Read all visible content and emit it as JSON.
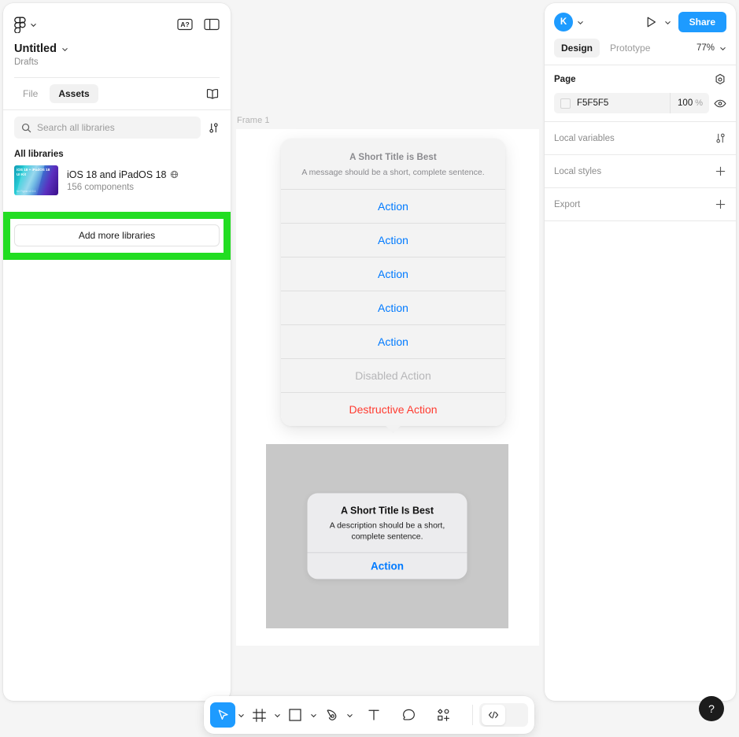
{
  "app": {
    "name": "Figma"
  },
  "left_panel": {
    "logo_icon": "figma-logo-icon",
    "menu_caret": "chevron-down-icon",
    "spellcheck_icon": "A?",
    "panel_toggle_icon": "layout-panel-icon",
    "doc_title": "Untitled",
    "doc_title_caret": "chevron-down-icon",
    "doc_location": "Drafts",
    "tabs": [
      {
        "label": "File",
        "active": false
      },
      {
        "label": "Assets",
        "active": true
      }
    ],
    "book_icon": "book-icon",
    "search": {
      "placeholder": "Search all libraries",
      "icon": "search-icon"
    },
    "filter_icon": "filter-sliders-icon",
    "section_label": "All libraries",
    "library": {
      "thumb_line1": "iOS 18 + iPadOS 18",
      "thumb_line2": "UI Kit",
      "thumb_line3": "for Figma  v2.0.1",
      "name": "iOS 18 and iPadOS 18",
      "published_icon": "globe-icon",
      "count": "156 components"
    },
    "add_libraries_label": "Add more libraries",
    "highlight_color": "#22dd22"
  },
  "canvas": {
    "frame_label": "Frame 1",
    "action_sheet": {
      "title": "A Short Title is Best",
      "message": "A message should be a short, complete sentence.",
      "rows": [
        {
          "label": "Action",
          "style": "default"
        },
        {
          "label": "Action",
          "style": "default"
        },
        {
          "label": "Action",
          "style": "default"
        },
        {
          "label": "Action",
          "style": "default"
        },
        {
          "label": "Action",
          "style": "default"
        },
        {
          "label": "Disabled Action",
          "style": "disabled"
        },
        {
          "label": "Destructive Action",
          "style": "destructive"
        }
      ]
    },
    "alert": {
      "title": "A Short Title Is Best",
      "description": "A description should be a short, complete sentence.",
      "action": "Action"
    },
    "colors": {
      "action_blue": "#007aff",
      "destructive_red": "#ff3b30",
      "alert_backdrop": "#c8c8c8"
    }
  },
  "right_panel": {
    "avatar_initial": "K",
    "avatar_caret": "chevron-down-icon",
    "play_icon": "present-play-icon",
    "play_caret": "chevron-down-icon",
    "share_label": "Share",
    "tabs": [
      {
        "label": "Design",
        "active": true
      },
      {
        "label": "Prototype",
        "active": false
      }
    ],
    "zoom_level": "77%",
    "zoom_caret": "chevron-down-icon",
    "page": {
      "title": "Page",
      "settings_icon": "page-settings-icon",
      "color_hex": "F5F5F5",
      "opacity": "100",
      "opacity_unit": "%",
      "visibility_icon": "eye-icon"
    },
    "sections": [
      {
        "label": "Local variables",
        "icon": "variables-sliders-icon"
      },
      {
        "label": "Local styles",
        "icon": "plus-icon"
      },
      {
        "label": "Export",
        "icon": "plus-icon"
      }
    ],
    "accent_color": "#1e9bff"
  },
  "toolbar": {
    "tools": [
      {
        "name": "move-tool",
        "icon": "cursor-icon",
        "active": true,
        "caret": true
      },
      {
        "name": "frame-tool",
        "icon": "frame-hash-icon",
        "active": false,
        "caret": true
      },
      {
        "name": "shape-tool",
        "icon": "square-icon",
        "active": false,
        "caret": true
      },
      {
        "name": "pen-tool",
        "icon": "pen-icon",
        "active": false,
        "caret": true
      },
      {
        "name": "text-tool",
        "icon": "text-T-icon",
        "active": false,
        "caret": false
      },
      {
        "name": "comment-tool",
        "icon": "comment-bubble-icon",
        "active": false,
        "caret": false
      },
      {
        "name": "actions-tool",
        "icon": "plugins-grid-icon",
        "active": false,
        "caret": false
      }
    ],
    "dev_mode_icon": "code-brackets-icon"
  },
  "help": {
    "label": "?",
    "icon": "question-mark-icon"
  }
}
